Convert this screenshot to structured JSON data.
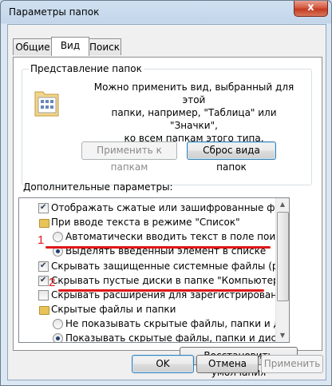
{
  "window": {
    "title": "Параметры папок",
    "close_label": "x"
  },
  "tabs": [
    {
      "label": "Общие"
    },
    {
      "label": "Вид"
    },
    {
      "label": "Поиск"
    }
  ],
  "folder_view": {
    "legend": "Представление папок",
    "description": [
      "Можно применить вид, выбранный для этой",
      "папки, например, \"Таблица\" или \"Значки\",",
      "ко всем папкам этого типа."
    ],
    "apply_button": "Применить к папкам",
    "reset_button": "Сброс вида папок"
  },
  "advanced": {
    "label": "Дополнительные параметры:",
    "items": [
      {
        "kind": "checkbox",
        "checked": true,
        "text": "Отображать сжатые или зашифрованные файлы NTI"
      },
      {
        "kind": "folder",
        "text": "При вводе текста в режиме \"Список\""
      },
      {
        "kind": "radio",
        "checked": false,
        "text": "Автоматически вводить текст в поле поиска"
      },
      {
        "kind": "radio",
        "checked": true,
        "text": "Выделять введенный элемент в списке"
      },
      {
        "kind": "checkbox",
        "checked": true,
        "text": "Скрывать защищенные системные файлы (рекомен,"
      },
      {
        "kind": "checkbox",
        "checked": true,
        "text": "Скрывать пустые диски в папке \"Компьютер\""
      },
      {
        "kind": "checkbox",
        "checked": false,
        "text": "Скрывать расширения для зарегистрированных типо"
      },
      {
        "kind": "folder",
        "text": "Скрытые файлы и папки"
      },
      {
        "kind": "radio",
        "checked": false,
        "text": "Не показывать скрытые файлы, папки и диски"
      },
      {
        "kind": "radio",
        "checked": true,
        "text": "Показывать скрытые файлы, папки и диски"
      }
    ],
    "restore_button": "Восстановить умолчания"
  },
  "annotations": {
    "marker_1": "1",
    "marker_2": "2"
  },
  "buttons": {
    "ok": "OK",
    "cancel": "Отмена",
    "apply": "Применить"
  },
  "colors": {
    "annotation_red": "#e01818",
    "title_bar": "#c3d6ea"
  }
}
